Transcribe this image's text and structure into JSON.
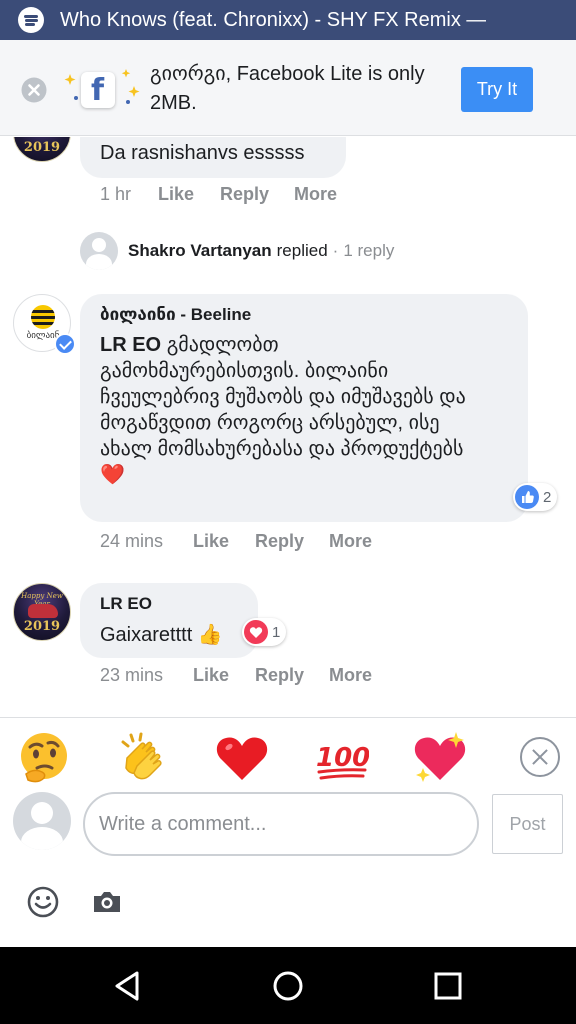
{
  "status_bar": {
    "notification_text": "Who Knows (feat. Chronixx) - SHY FX Remix —",
    "icon": "spotify-icon"
  },
  "promo": {
    "message": "გიორგი, Facebook Lite is only 2MB.",
    "button_label": "Try It",
    "icons": [
      "close-icon",
      "facebook-lite-logo"
    ]
  },
  "comments": [
    {
      "id": "c1",
      "text": "Da rasnishanvs esssss",
      "time": "1 hr",
      "actions": [
        "Like",
        "Reply",
        "More"
      ]
    },
    {
      "id": "replies",
      "name": "Shakro Vartanyan",
      "replied_label": "replied",
      "sep": "·",
      "count_label": "1 reply"
    },
    {
      "id": "c2",
      "page_name": "ბილაინი - Beeline",
      "avatar_label": "ბილაინ",
      "mention": "LR EO",
      "text": "გმადლობთ გამოხმაურებისთვის. ბილაინი ჩვეულებრივ მუშაობს და იმუშავებს და მოგაწვდით როგორც არსებულ, ისე ახალ მომსახურებასა და პროდუქტებს",
      "emoji": "❤️",
      "reaction_count": "2",
      "time": "24 mins",
      "actions": [
        "Like",
        "Reply",
        "More"
      ]
    },
    {
      "id": "c3",
      "name": "LR EO",
      "avatar_year": "2019",
      "text": "Gaixaretttt",
      "emoji": "👍",
      "reaction_count": "1",
      "time": "23 mins",
      "actions": [
        "Like",
        "Reply",
        "More"
      ]
    }
  ],
  "reactions": [
    "🤔",
    "👏",
    "❤️",
    "💯",
    "💖"
  ],
  "composer": {
    "placeholder": "Write a comment...",
    "post_label": "Post",
    "tools": [
      "smiley-icon",
      "camera-icon"
    ]
  },
  "nav": [
    "back-icon",
    "home-icon",
    "recents-icon"
  ],
  "colors": {
    "status_bar": "#3b4c78",
    "accent": "#3b8ef5",
    "bubble": "#eff1f4",
    "like": "#4a8af4",
    "love": "#f23b58"
  }
}
